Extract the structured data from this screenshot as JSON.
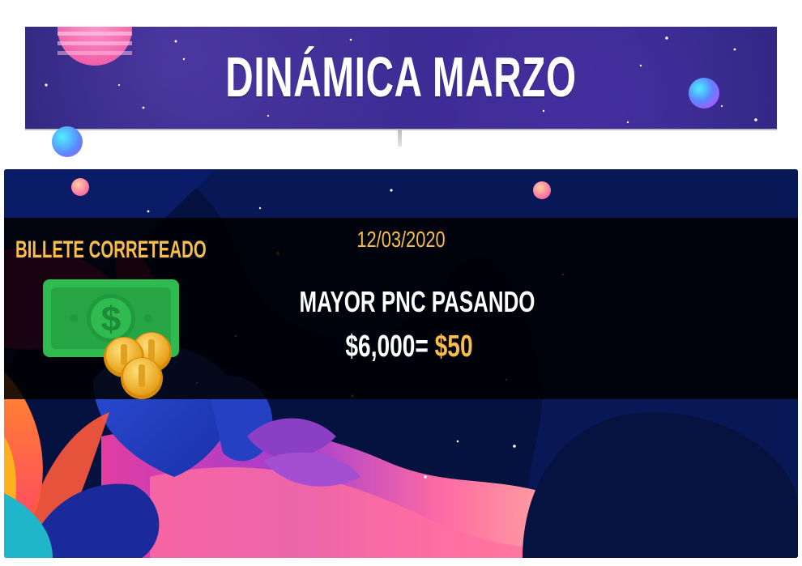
{
  "banner": {
    "title": "DINÁMICA MARZO"
  },
  "promo": {
    "label": "BILLETE CORRETEADO",
    "date": "12/03/2020",
    "headline": "MAYOR PNC PASANDO",
    "amount": "$6,000",
    "equals": "=",
    "prize": "$50"
  },
  "icons": {
    "money": "cash-and-coins-icon"
  },
  "colors": {
    "banner_purple": "#3a2b8f",
    "card_navy": "#05113f",
    "accent_yellow": "#f6bd4d",
    "cash_green": "#2fbb4f",
    "coin_gold": "#f3b920"
  }
}
